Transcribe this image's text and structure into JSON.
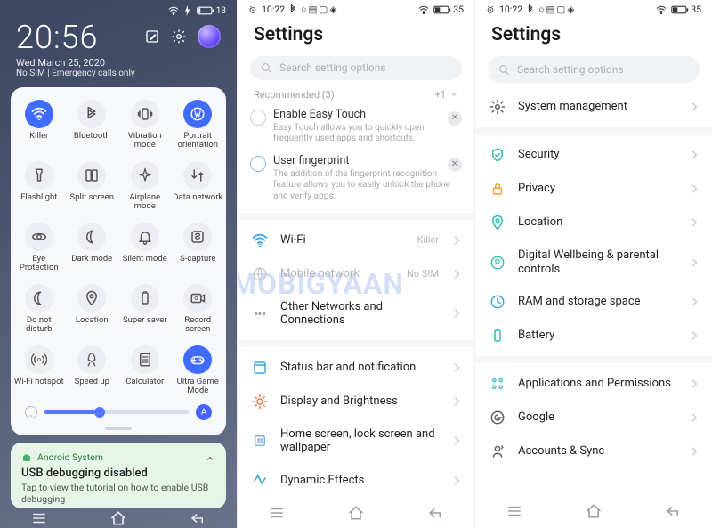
{
  "watermark": "MOBIGYAAN",
  "left": {
    "status": {
      "battery_pct": "13"
    },
    "clock": "20:56",
    "date": "Wed March 25, 2020",
    "sim": "No SIM | Emergency calls only",
    "tiles": [
      {
        "icon": "wifi",
        "label": "Killer",
        "active": true
      },
      {
        "icon": "bluetooth",
        "label": "Bluetooth",
        "active": false
      },
      {
        "icon": "vibrate",
        "label": "Vibration mode",
        "active": false
      },
      {
        "icon": "portrait",
        "label": "Portrait orientation",
        "active": true
      },
      {
        "icon": "flashlight",
        "label": "Flashlight",
        "active": false
      },
      {
        "icon": "split",
        "label": "Split screen",
        "active": false
      },
      {
        "icon": "airplane",
        "label": "Airplane mode",
        "active": false
      },
      {
        "icon": "data",
        "label": "Data network",
        "active": false
      },
      {
        "icon": "eye",
        "label": "Eye Protection",
        "active": false
      },
      {
        "icon": "dark",
        "label": "Dark mode",
        "active": false
      },
      {
        "icon": "bell",
        "label": "Silent mode",
        "active": false
      },
      {
        "icon": "scapture",
        "label": "S-capture",
        "active": false
      },
      {
        "icon": "dnd",
        "label": "Do not disturb",
        "active": false
      },
      {
        "icon": "location",
        "label": "Location",
        "active": false
      },
      {
        "icon": "battery",
        "label": "Super saver",
        "active": false
      },
      {
        "icon": "record",
        "label": "Record screen",
        "active": false
      },
      {
        "icon": "hotspot",
        "label": "Wi-Fi hotspot",
        "active": false
      },
      {
        "icon": "rocket",
        "label": "Speed up",
        "active": false
      },
      {
        "icon": "calc",
        "label": "Calculator",
        "active": false
      },
      {
        "icon": "game",
        "label": "Ultra Game Mode",
        "active": true
      }
    ],
    "brightness_auto": "A",
    "notif": {
      "app": "Android System",
      "title": "USB debugging disabled",
      "sub": "Tap to view the tutorial on how to enable USB debugging"
    }
  },
  "mid": {
    "status_time": "10:22",
    "status_batt": "35",
    "title": "Settings",
    "search_placeholder": "Search setting options",
    "recommended_label": "Recommended (3)",
    "recommended_extra": "+1",
    "recos": [
      {
        "title": "Enable Easy Touch",
        "sub": "Easy Touch allows you to quickly open frequently used apps and shortcuts."
      },
      {
        "title": "User fingerprint",
        "sub": "The addition of the fingerprint recognition feature allows you to easily unlock the phone and verify apps."
      }
    ],
    "rows": [
      {
        "icon": "wifi",
        "label": "Wi-Fi",
        "value": "Killer",
        "color": "#35a3e6",
        "muted": false
      },
      {
        "icon": "globe",
        "label": "Mobile network",
        "value": "No SIM",
        "color": "#3ec7c1",
        "muted": true
      },
      {
        "icon": "dots",
        "label": "Other Networks and Connections",
        "value": "",
        "color": "#444",
        "muted": false
      },
      {
        "icon": "statusbar",
        "label": "Status bar and notification",
        "value": "",
        "color": "#3aa8dc",
        "muted": false
      },
      {
        "icon": "brightness",
        "label": "Display and Brightness",
        "value": "",
        "color": "#f07b4a",
        "muted": false
      },
      {
        "icon": "home",
        "label": "Home screen, lock screen and wallpaper",
        "value": "",
        "color": "#7fb5d8",
        "muted": false
      },
      {
        "icon": "dynamic",
        "label": "Dynamic Effects",
        "value": "",
        "color": "#2aa0cf",
        "muted": false
      }
    ]
  },
  "right": {
    "status_time": "10:22",
    "status_batt": "35",
    "title": "Settings",
    "search_placeholder": "Search setting options",
    "rows": [
      {
        "icon": "gear",
        "label": "System management",
        "color": "#5a5f66"
      },
      {
        "icon": "shield",
        "label": "Security",
        "color": "#2fb9b1"
      },
      {
        "icon": "lock",
        "label": "Privacy",
        "color": "#f0a03a"
      },
      {
        "icon": "pin",
        "label": "Location",
        "color": "#2fb9b1"
      },
      {
        "icon": "wellbeing",
        "label": "Digital Wellbeing & parental controls",
        "color": "#39c3b7"
      },
      {
        "icon": "ram",
        "label": "RAM and storage space",
        "color": "#3aa8dc"
      },
      {
        "icon": "battery",
        "label": "Battery",
        "color": "#2fb9b1"
      },
      {
        "icon": "apps",
        "label": "Applications and Permissions",
        "color": "#39c3b7"
      },
      {
        "icon": "google",
        "label": "Google",
        "color": "#5a5f66"
      },
      {
        "icon": "sync",
        "label": "Accounts & Sync",
        "color": "#5a5f66"
      }
    ]
  }
}
